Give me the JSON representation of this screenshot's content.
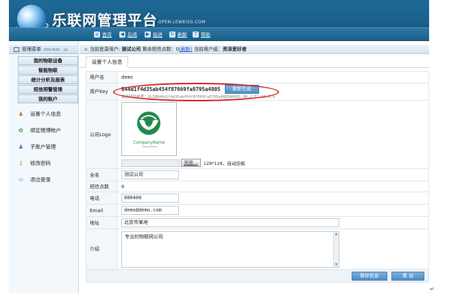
{
  "header": {
    "title": "乐联网管理平台",
    "url": "OPEN.LEWEI50.COM",
    "nav": [
      {
        "label": "首页",
        "icon": "home-icon",
        "glyph": "⌂"
      },
      {
        "label": "后退",
        "icon": "back-arrow-icon",
        "glyph": "◀"
      },
      {
        "label": "前进",
        "icon": "forward-arrow-icon",
        "glyph": "▶"
      },
      {
        "label": "刷新",
        "icon": "refresh-icon",
        "glyph": "↻"
      },
      {
        "label": "帮助",
        "icon": "help-icon",
        "glyph": "?"
      }
    ]
  },
  "sidebar": {
    "menu_title": "管理菜单",
    "menu_title_en": "MAIN MENU",
    "categories": [
      "我的物联设备",
      "智能物联",
      "统计分析及报表",
      "短信预警管理",
      "我的账户"
    ],
    "items": [
      {
        "label": "设置个人信息",
        "icon": "user-settings-icon"
      },
      {
        "label": "绑定微博帐户",
        "icon": "weibo-bind-icon"
      },
      {
        "label": "子账户管理",
        "icon": "sub-account-icon"
      },
      {
        "label": "修改密码",
        "icon": "key-icon"
      },
      {
        "label": "退出登录",
        "icon": "logout-icon"
      }
    ]
  },
  "status": {
    "prefix": "当前登录用户:",
    "user": "测试公司",
    "sms_label": "剩余短信点数：",
    "sms_count": "0",
    "refresh_link": "(刷新)",
    "group_label": "当前用户组：",
    "group": "资深爱好者"
  },
  "tab": {
    "label": "设置个人信息"
  },
  "form": {
    "username_label": "用户名",
    "username": "demo",
    "userkey_label": "用户Key",
    "userkey": "844d1f4d35ab454f87669fa9795a4805",
    "regen_button": "重新生成",
    "userkey_hint": "发送代码参考：ULIN844d1f4d35ab454f87669fa9795a4805NA001:96.2;T1:25.0;$",
    "logo_label": "公司Logo",
    "logo_text": "CompanyName",
    "browse_button": "浏览...",
    "logo_hint": "128*128，自动压缩",
    "fullname_label": "全名",
    "fullname": "测试公司",
    "sms_label": "短信点数",
    "sms": "0",
    "phone_label": "电话",
    "phone": "800400",
    "email_label": "Email",
    "email": "demo@demo.com",
    "address_label": "地址",
    "address": "北京市某地",
    "intro_label": "介绍",
    "intro": "专业的物联网公司",
    "save_button": "保存信息",
    "reset_button": "重  设"
  },
  "colors": {
    "header": "#1b5f89",
    "accent": "#4d8dc5",
    "highlight": "#d51a1a",
    "logo_green": "#1f8a4c"
  }
}
